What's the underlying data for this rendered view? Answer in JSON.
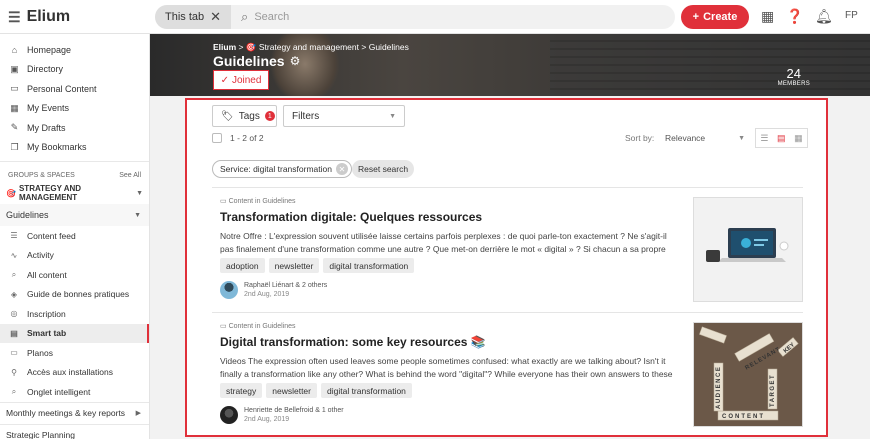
{
  "app": {
    "name": "Elium"
  },
  "search": {
    "scope_chip": "This tab",
    "placeholder": "Search"
  },
  "header": {
    "create_label": "Create",
    "user_initials": "FP"
  },
  "sidebar": {
    "main_items": [
      {
        "label": "Homepage",
        "icon": "home-icon"
      },
      {
        "label": "Directory",
        "icon": "directory-icon"
      },
      {
        "label": "Personal Content",
        "icon": "document-icon"
      },
      {
        "label": "My Events",
        "icon": "calendar-icon"
      },
      {
        "label": "My Drafts",
        "icon": "drafts-icon"
      },
      {
        "label": "My Bookmarks",
        "icon": "bookmark-icon"
      }
    ],
    "groups_label": "GROUPS & SPACES",
    "see_all": "See All",
    "group_name": "STRATEGY AND MANAGEMENT",
    "space_name": "Guidelines",
    "space_items": [
      {
        "label": "Content feed",
        "icon": "feed-icon"
      },
      {
        "label": "Activity",
        "icon": "activity-icon"
      },
      {
        "label": "All content",
        "icon": "search-icon"
      },
      {
        "label": "Guide de bonnes pratiques",
        "icon": "layers-icon"
      },
      {
        "label": "Inscription",
        "icon": "globe-icon"
      },
      {
        "label": "Smart tab",
        "icon": "smart-tab-icon"
      },
      {
        "label": "Planos",
        "icon": "doc-icon"
      },
      {
        "label": "Accès aux installations",
        "icon": "link-icon"
      },
      {
        "label": "Onglet intelligent",
        "icon": "search-icon"
      }
    ],
    "next_group": "Monthly meetings & key reports",
    "cut_group": "Strategic Planning"
  },
  "banner": {
    "breadcrumb_root": "Elium",
    "breadcrumb_group": "Strategy and management",
    "breadcrumb_space": "Guidelines",
    "title": "Guidelines",
    "joined_label": "Joined",
    "members_count": "24",
    "members_label": "MEMBERS"
  },
  "toolbar": {
    "tags_label": "Tags",
    "tags_count": "1",
    "filters_label": "Filters",
    "result_count": "1 - 2 of 2",
    "sort_label": "Sort by:",
    "sort_value": "Relevance"
  },
  "active_filter": {
    "label": "Service: digital transformation",
    "reset_label": "Reset search"
  },
  "cards": [
    {
      "meta": "Content in Guidelines",
      "title": "Transformation digitale: Quelques ressources",
      "excerpt": "Notre Offre : L'expression souvent utilisée laisse certains parfois perplexes : de quoi parle-ton exactement ? Ne s'agit-il pas finalement d'une transformation comme une autre ? Que met-on derrière le mot « digital » ? Si chacun a sa propre réponse ...",
      "tags": [
        "adoption",
        "newsletter",
        "digital transformation"
      ],
      "author": "Raphaël Liénart & 2 others",
      "date": "2nd Aug, 2019"
    },
    {
      "meta": "Content in Guidelines",
      "title": "Digital transformation: some key resources 📚",
      "excerpt": "Videos The expression often used leaves some people sometimes confused: what exactly are we talking about? Isn't it finally a transformation like any other? What is behind the word \"digital\"? While everyone has their own answers to these question...",
      "tags": [
        "strategy",
        "newsletter",
        "digital transformation"
      ],
      "author": "Henriette de Bellefroid & 1 other",
      "date": "2nd Aug, 2019"
    }
  ],
  "thumb_words": [
    "RELEVANT",
    "AUDIENCE",
    "CONTENT",
    "TARGET",
    "KEY"
  ],
  "colors": {
    "accent": "#e0303a"
  }
}
